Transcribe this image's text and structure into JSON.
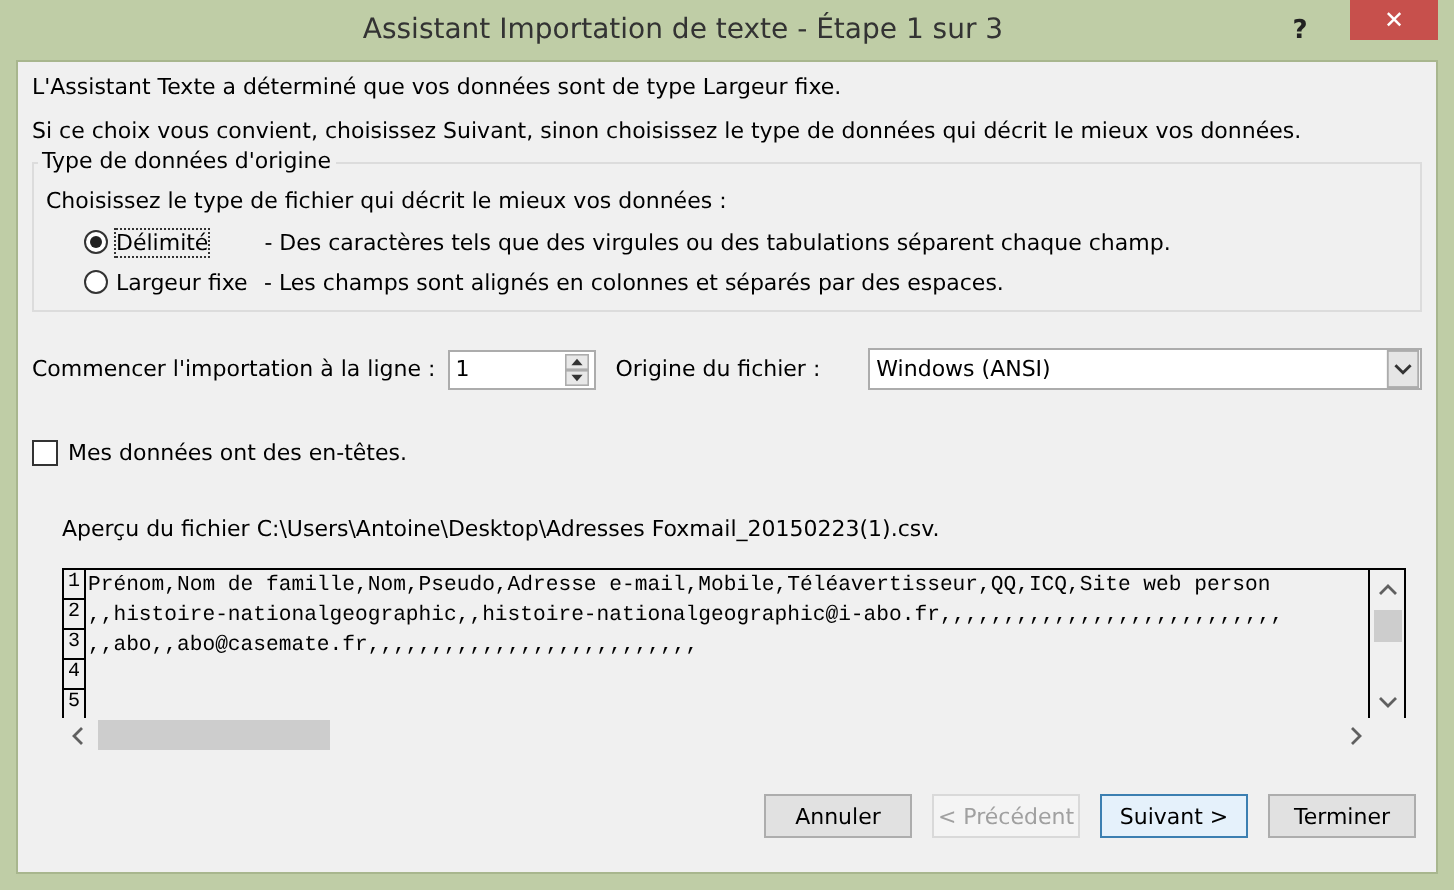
{
  "window": {
    "title": "Assistant Importation de texte - Étape 1 sur 3",
    "help": "?",
    "close": "✕"
  },
  "intro": [
    "L'Assistant Texte a déterminé que vos données sont de type Largeur fixe.",
    "Si ce choix vous convient, choisissez Suivant, sinon choisissez le type de données qui décrit le mieux vos données."
  ],
  "group": {
    "title": "Type de données d'origine",
    "prompt": "Choisissez le type de fichier qui décrit le mieux vos données :",
    "options": [
      {
        "label": "Délimité",
        "description": "- Des caractères tels que des virgules ou des tabulations séparent chaque champ.",
        "selected": true
      },
      {
        "label": "Largeur fixe",
        "description": "- Les champs sont alignés en colonnes et séparés par des espaces.",
        "selected": false
      }
    ]
  },
  "start_row": {
    "label": "Commencer l'importation à la ligne :",
    "value": "1"
  },
  "origin": {
    "label": "Origine du fichier :",
    "value": "Windows (ANSI)"
  },
  "headers": {
    "label": "Mes données ont des en-têtes.",
    "checked": false
  },
  "preview": {
    "label": "Aperçu du fichier C:\\Users\\Antoine\\Desktop\\Adresses Foxmail_20150223(1).csv.",
    "lines": [
      {
        "number": "1",
        "text": "Prénom,Nom de famille,Nom,Pseudo,Adresse e-mail,Mobile,Téléavertisseur,QQ,ICQ,Site web person"
      },
      {
        "number": "2",
        "text": ",,histoire-nationalgeographic,,histoire-nationalgeographic@i-abo.fr,,,,,,,,,,,,,,,,,,,,,,,,,,,"
      },
      {
        "number": "3",
        "text": ",,abo,,abo@casemate.fr,,,,,,,,,,,,,,,,,,,,,,,,,,"
      },
      {
        "number": "4"
      },
      {
        "number": "5"
      }
    ]
  },
  "buttons": [
    {
      "label": "Annuler",
      "disabled": false,
      "selected": false
    },
    {
      "label": "< Précédent",
      "disabled": true,
      "selected": false
    },
    {
      "label": "Suivant >",
      "disabled": false,
      "selected": true
    },
    {
      "label": "Terminer",
      "disabled": false,
      "selected": false
    }
  ]
}
